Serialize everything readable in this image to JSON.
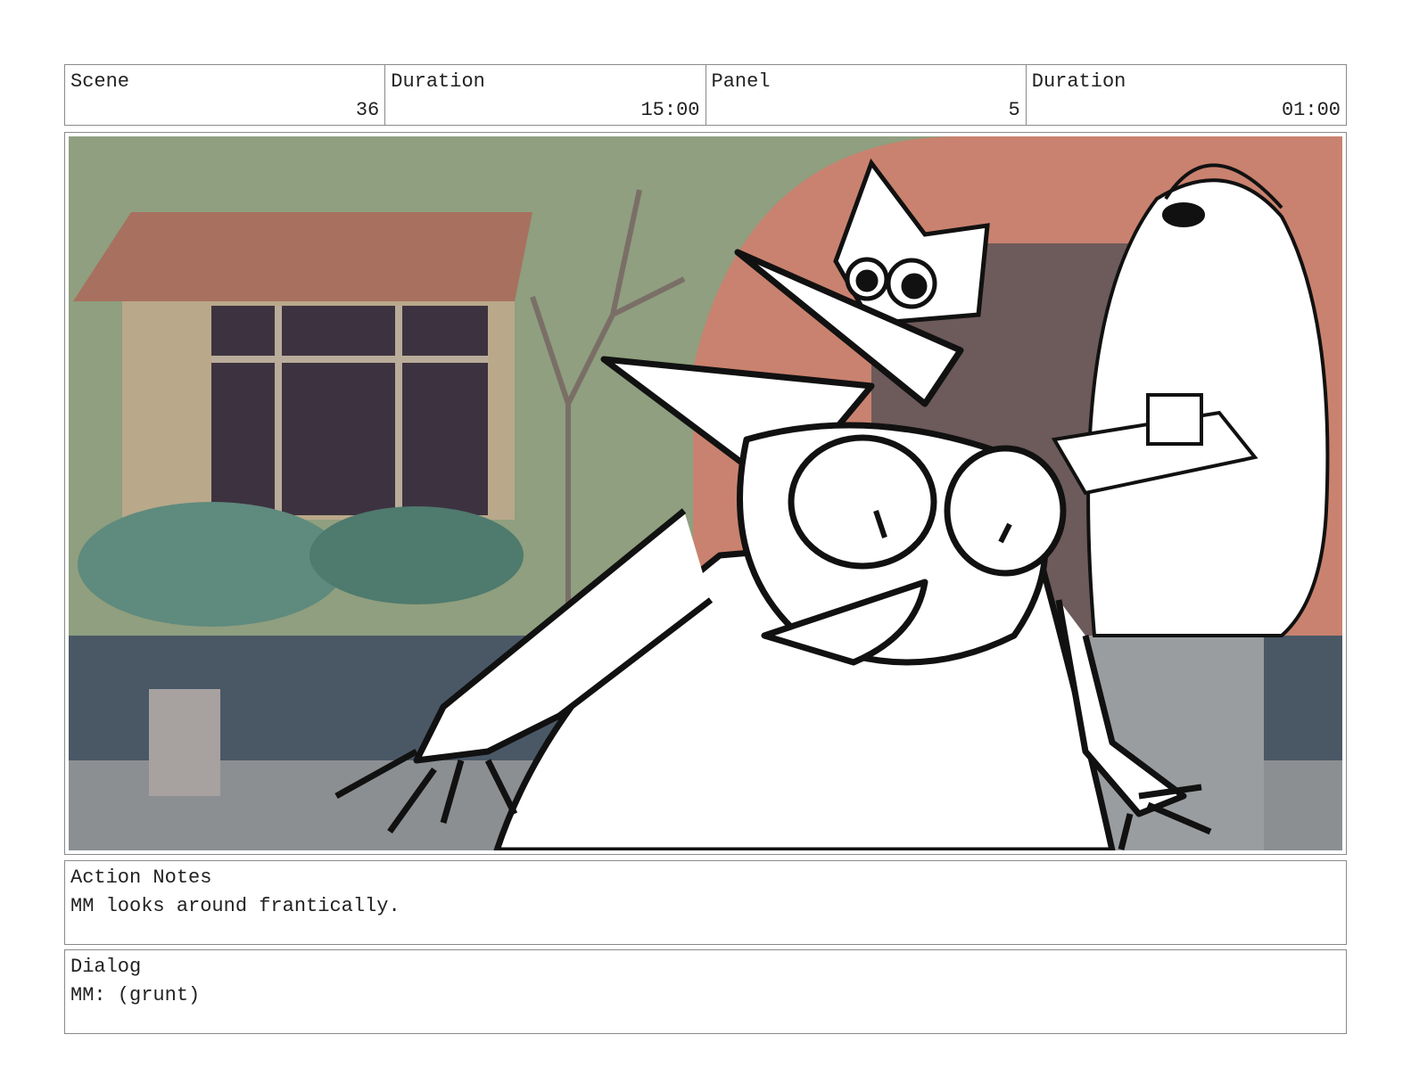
{
  "header": {
    "scene_label": "Scene",
    "scene_value": "36",
    "duration_label": "Duration",
    "duration_value": "15:00",
    "panel_label": "Panel",
    "panel_value": "5",
    "panel_duration_label": "Duration",
    "panel_duration_value": "01:00"
  },
  "action_notes": {
    "label": "Action Notes",
    "text": "MM looks around frantically."
  },
  "dialog": {
    "label": "Dialog",
    "text": "MM: (grunt)"
  },
  "colors": {
    "border": "#8a8a8a",
    "wall": "#8f9f7f",
    "roof": "#a8705f",
    "window": "#3d3340",
    "floor": "#4a5866",
    "arch": "#c9826f"
  }
}
